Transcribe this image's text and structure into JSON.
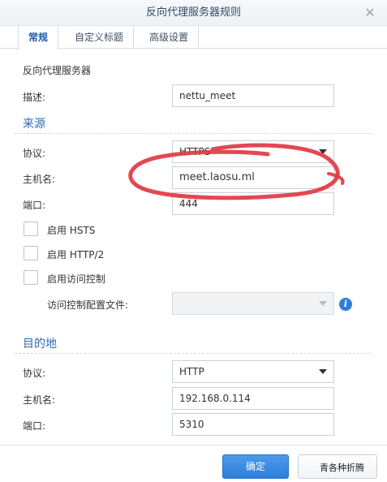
{
  "window": {
    "title": "反向代理服务器规则",
    "close_glyph": "✕"
  },
  "tabs": [
    {
      "label": "常规"
    },
    {
      "label": "自定义标题"
    },
    {
      "label": "高级设置"
    }
  ],
  "general": {
    "heading": "反向代理服务器",
    "description_label": "描述:",
    "description_value": "nettu_meet"
  },
  "source": {
    "title": "来源",
    "protocol_label": "协议:",
    "protocol_value": "HTTPS",
    "hostname_label": "主机名:",
    "hostname_value": "meet.laosu.ml",
    "port_label": "端口:",
    "port_value": "444",
    "hsts_label": "启用 HSTS",
    "http2_label": "启用 HTTP/2",
    "access_control_label": "启用访问控制",
    "access_profile_label": "访问控制配置文件:",
    "access_profile_value": ""
  },
  "destination": {
    "title": "目的地",
    "protocol_label": "协议:",
    "protocol_value": "HTTP",
    "hostname_label": "主机名:",
    "hostname_value": "192.168.0.114",
    "port_label": "端口:",
    "port_value": "5310"
  },
  "footer": {
    "ok_label": "确定",
    "watermark": "青各种折腾"
  },
  "colors": {
    "accent": "#2a6bb8",
    "primary_button": "#2d7fd8",
    "annotation": "#e0343f"
  },
  "icons": {
    "info": "info-icon",
    "dropdown": "chevron-down-icon"
  }
}
